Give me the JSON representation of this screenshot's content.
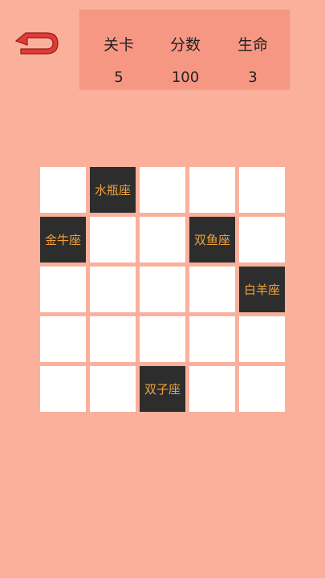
{
  "header": {
    "back_icon": "return-arrow-icon",
    "stats": [
      {
        "label": "关卡",
        "value": "5"
      },
      {
        "label": "分数",
        "value": "100"
      },
      {
        "label": "生命",
        "value": "3"
      }
    ]
  },
  "board": {
    "rows": 5,
    "cols": 5,
    "zodiac_cells": [
      {
        "row": 0,
        "col": 1,
        "label": "水瓶座"
      },
      {
        "row": 1,
        "col": 0,
        "label": "金牛座"
      },
      {
        "row": 1,
        "col": 3,
        "label": "双鱼座"
      },
      {
        "row": 2,
        "col": 4,
        "label": "白羊座"
      },
      {
        "row": 4,
        "col": 2,
        "label": "双子座"
      }
    ]
  },
  "colors": {
    "background": "#fbb09c",
    "panel": "#f69783",
    "dark_tile": "#2d2d2d",
    "tile_text": "#f1a23a",
    "back_icon_fill": "#e23b36"
  }
}
